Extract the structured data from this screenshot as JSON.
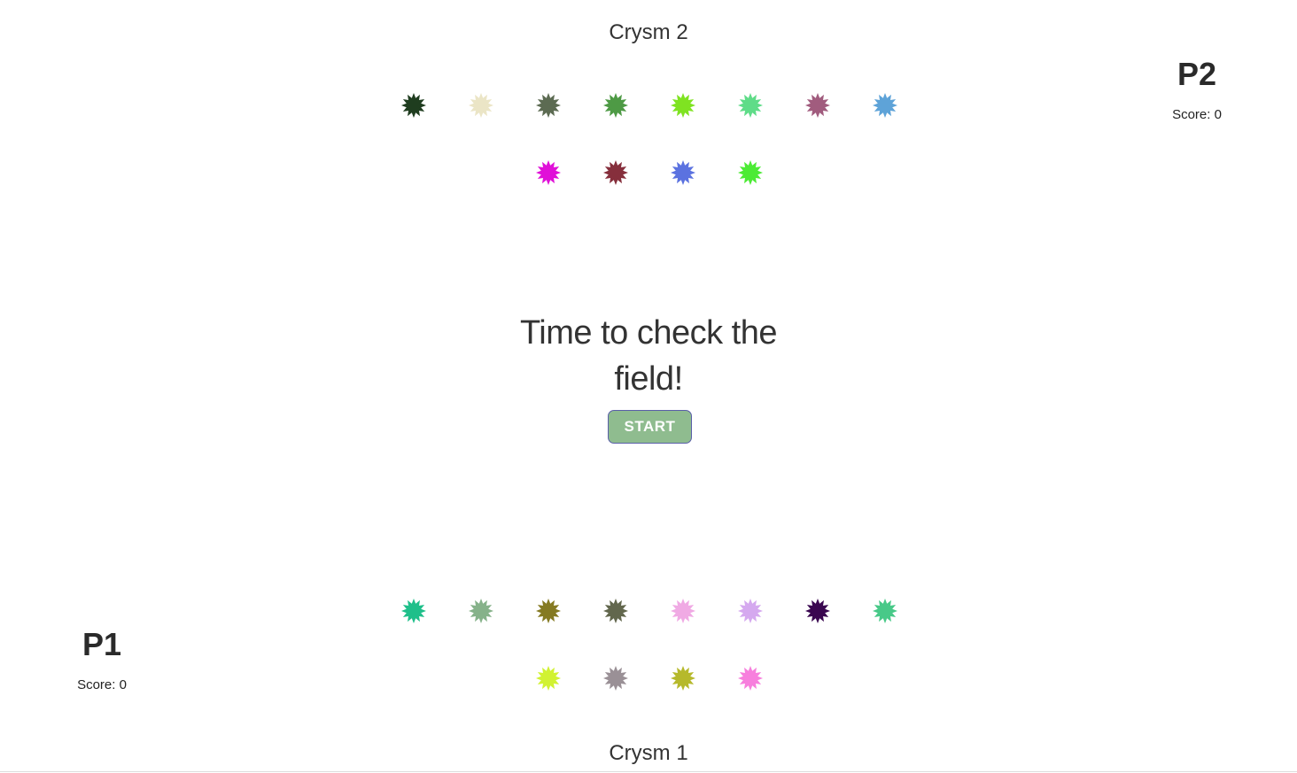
{
  "fields": {
    "top_title": "Crysm 2",
    "bottom_title": "Crysm 1"
  },
  "players": {
    "p2": {
      "name": "P2",
      "score": "Score: 0"
    },
    "p1": {
      "name": "P1",
      "score": "Score: 0"
    }
  },
  "message": "Time to check the field!",
  "start_label": "START",
  "crystals": {
    "top": [
      [
        "#1f3d1f",
        "#ebe5c6",
        "#5c6b52",
        "#4e9a45",
        "#7fe321",
        "#5fdc88",
        "#a15c7e",
        "#5ea3d8"
      ],
      [
        "#e010d8",
        "#862f3c",
        "#5b72e0",
        "#4ceb35"
      ]
    ],
    "bottom": [
      [
        "#1fbf8a",
        "#86b28a",
        "#857a22",
        "#62674d",
        "#f0aae4",
        "#d5a9ef",
        "#3a0750",
        "#48c988"
      ],
      [
        "#d1f232",
        "#9a9096",
        "#b6b92c",
        "#f77fdd"
      ]
    ]
  }
}
